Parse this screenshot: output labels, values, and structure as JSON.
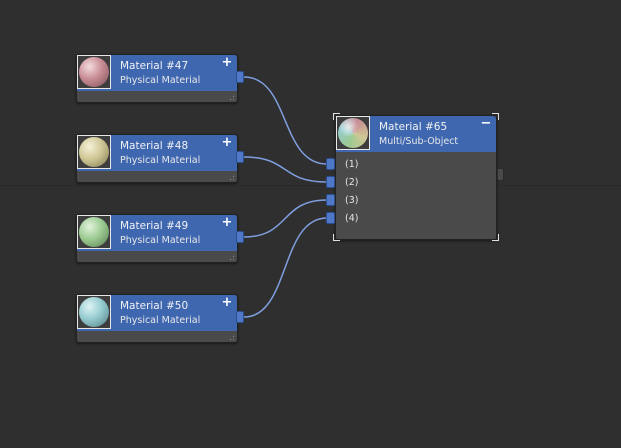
{
  "nodes": [
    {
      "title": "Material #47",
      "subtitle": "Physical Material",
      "control": "+",
      "sphere_color": "#c88c94"
    },
    {
      "title": "Material #48",
      "subtitle": "Physical Material",
      "control": "+",
      "sphere_color": "#cfc795"
    },
    {
      "title": "Material #49",
      "subtitle": "Physical Material",
      "control": "+",
      "sphere_color": "#9ccb92"
    },
    {
      "title": "Material #50",
      "subtitle": "Physical Material",
      "control": "+",
      "sphere_color": "#94cbcf"
    }
  ],
  "multi_node": {
    "title": "Material #65",
    "subtitle": "Multi/Sub-Object",
    "control": "−",
    "slots": [
      "(1)",
      "(2)",
      "(3)",
      "(4)"
    ]
  },
  "colors": {
    "canvas": "#2f2f2f",
    "node_header": "#3e67b0",
    "node_body": "#4a4a4a",
    "port": "#4f79c6",
    "wire": "#7f9fe0"
  }
}
